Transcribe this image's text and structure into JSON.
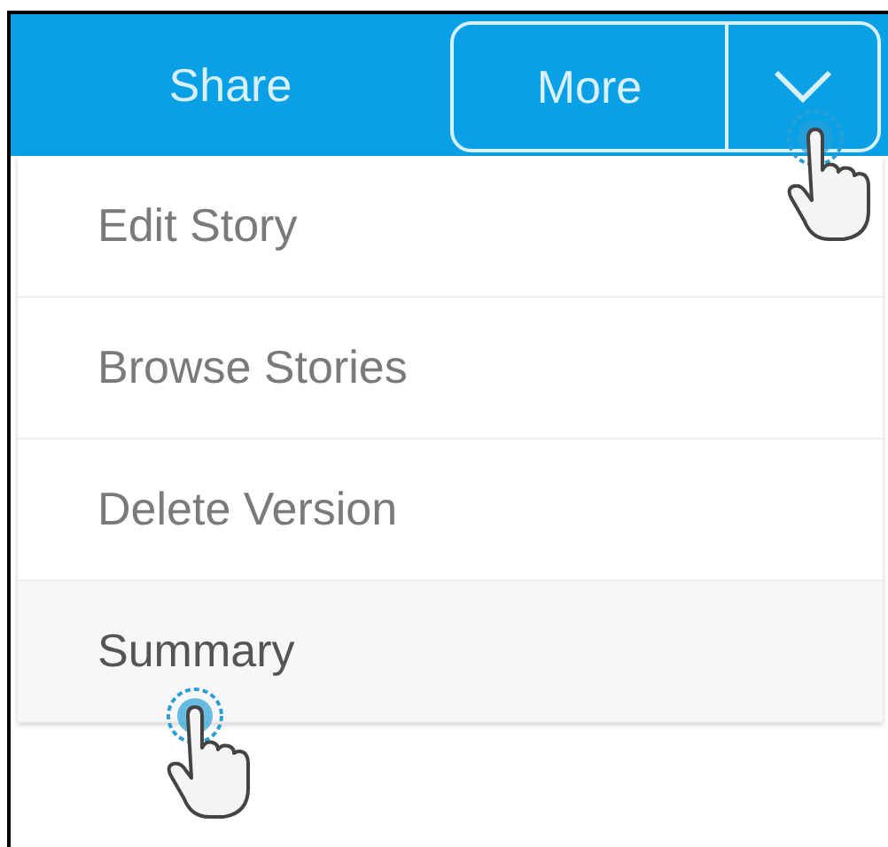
{
  "toolbar": {
    "share_label": "Share",
    "more_button": {
      "label": "More"
    }
  },
  "menu": {
    "items": [
      {
        "label": "Edit Story",
        "selected": false
      },
      {
        "label": "Browse Stories",
        "selected": false
      },
      {
        "label": "Delete Version",
        "selected": false
      },
      {
        "label": "Summary",
        "selected": true
      }
    ]
  }
}
